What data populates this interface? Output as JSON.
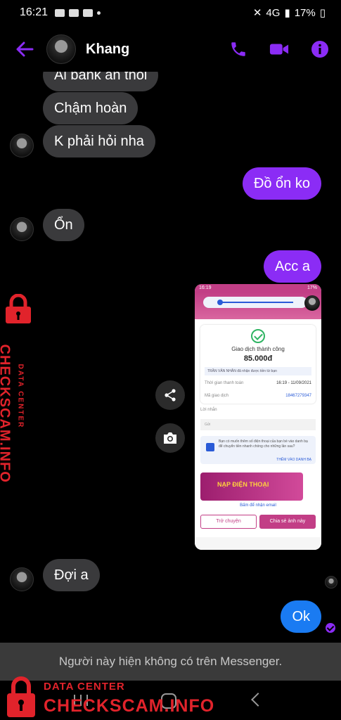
{
  "status_bar": {
    "time": "16:21",
    "signal": "4G",
    "battery": "17%"
  },
  "header": {
    "contact_name": "Khang"
  },
  "messages": [
    {
      "dir": "in",
      "text": "Ai bank an thôi"
    },
    {
      "dir": "in",
      "text": "Chậm hoàn"
    },
    {
      "dir": "in",
      "text": "K phải hỏi nha"
    },
    {
      "dir": "out",
      "text": "Đồ ổn ko"
    },
    {
      "dir": "in",
      "text": "Ổn"
    },
    {
      "dir": "out",
      "text": "Acc a"
    },
    {
      "dir": "in",
      "text": "Đợi a"
    },
    {
      "dir": "out",
      "text": "Ok"
    }
  ],
  "shared_image": {
    "status_time": "16:19",
    "status_right": "17%",
    "success_title": "Giao dịch thành công",
    "amount": "85.000đ",
    "receiver_note": "TRẦN VĂN NHÂN đã nhận được tiền từ bạn",
    "time_label": "Thời gian thanh toán",
    "time_value": "16:19 - 11/09/2021",
    "tx_label": "Mã giao dịch",
    "tx_value": "18467279347",
    "message_label": "Lời nhắn",
    "message_value": "Gửi",
    "info_text": "Bạn có muốn thêm số điện thoại của bạn bè vào danh bạ để chuyển tiền nhanh chóng cho những lần sau?",
    "info_link": "THÊM VÀO DANH BẠ",
    "banner_text": "NẠP ĐIỆN THOẠI",
    "email_text": "Bấm để nhận email",
    "button_back": "Trở chuyện",
    "button_share": "Chia sẻ ảnh này"
  },
  "notice": "Người này hiện không có trên Messenger.",
  "watermark": {
    "line1": "DATA CENTER",
    "line2": "CHECKSCAM.INFO"
  },
  "colors": {
    "outgoing": "#8b2cf5",
    "incoming": "#3a3a3c",
    "last_outgoing": "#1a7bf2",
    "accent": "#8b2cf5",
    "watermark": "#e1232b"
  }
}
